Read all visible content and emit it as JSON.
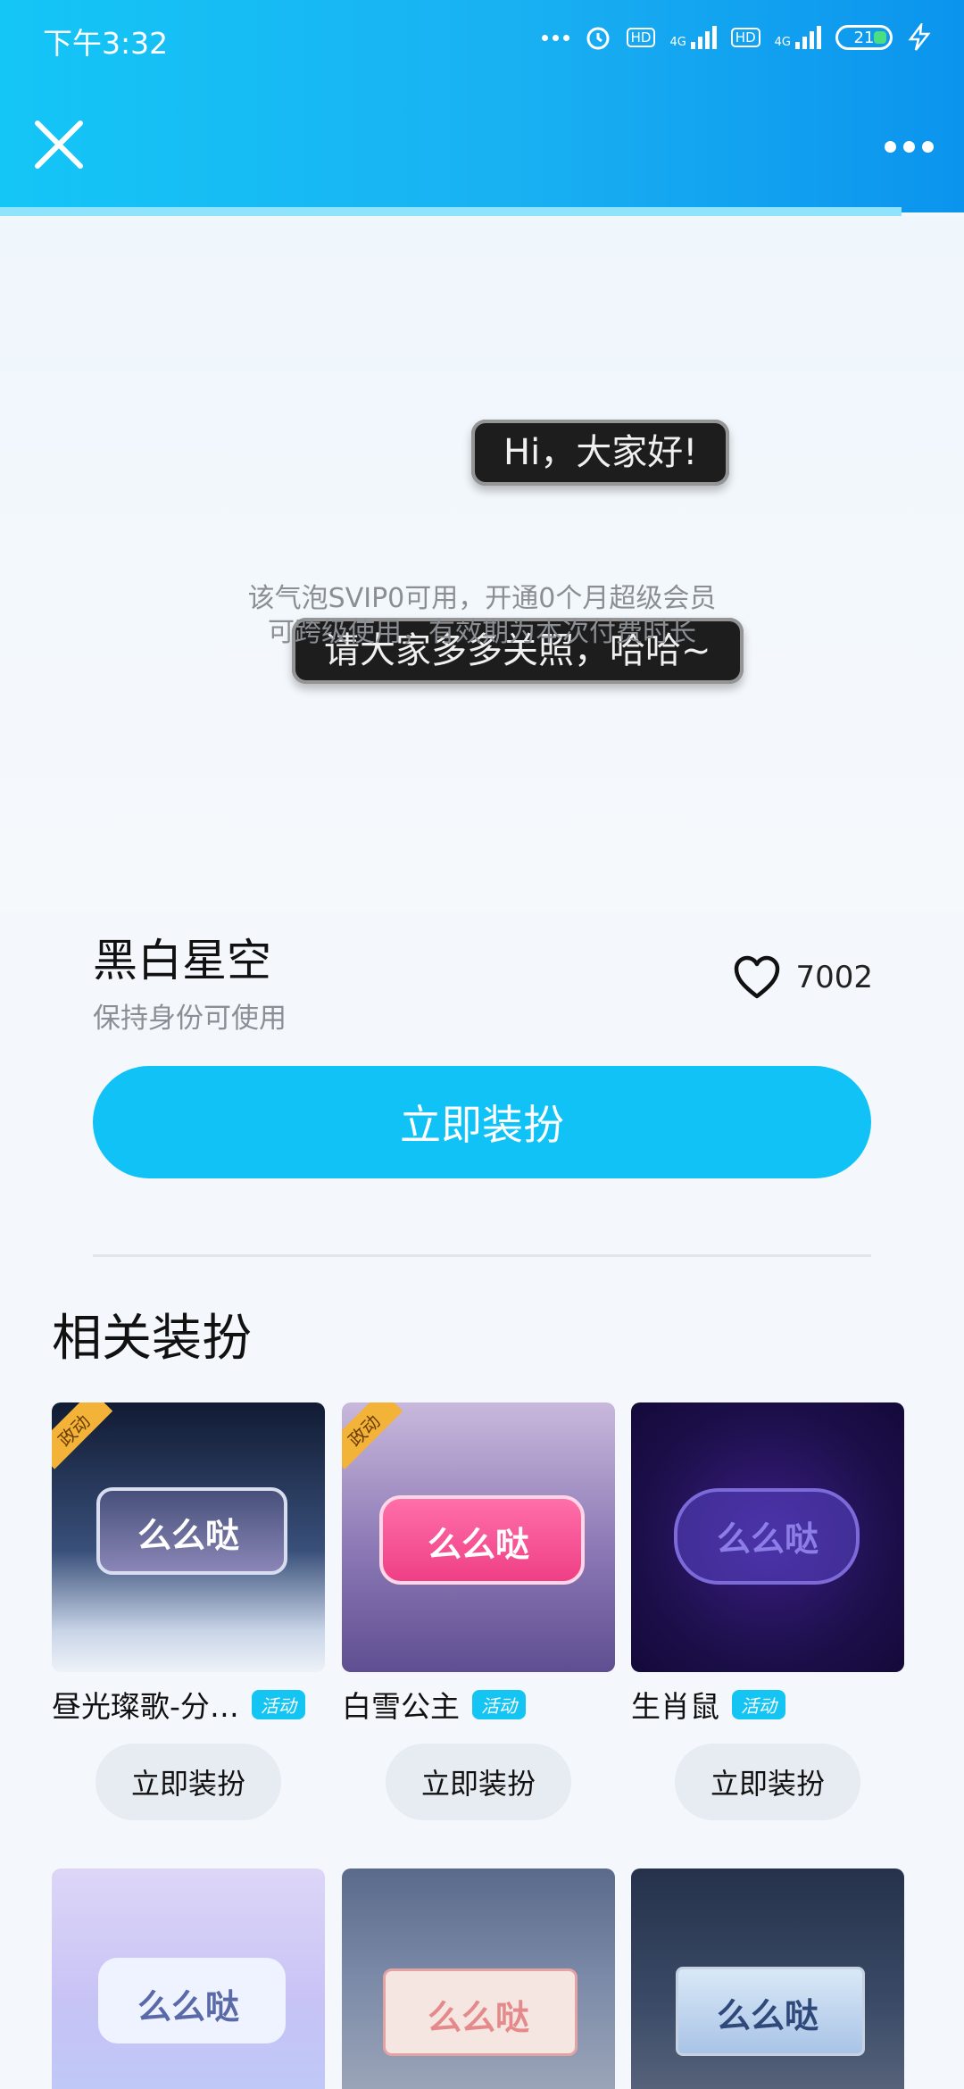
{
  "status_bar": {
    "time": "下午3:32",
    "network1": "4G",
    "network2": "4G",
    "hd1": "HD",
    "hd2": "HD",
    "battery": "21"
  },
  "preview": {
    "bubble1": "Hi，大家好!",
    "bubble2": "请大家多多关照，哈哈~",
    "notice_line1": "该气泡SVIP0可用，开通0个月超级会员",
    "notice_line2": "可跨级使用，有效期为本次付费时长"
  },
  "item": {
    "title": "黑白星空",
    "subtitle": "保持身份可使用",
    "likes": "7002",
    "button": "立即装扮"
  },
  "related": {
    "title": "相关装扮",
    "cards": [
      {
        "name": "昼光璨歌-分…",
        "badge": "活动",
        "corner": "政动",
        "bubble_text": "么么哒",
        "button": "立即装扮"
      },
      {
        "name": "白雪公主",
        "badge": "活动",
        "corner": "政动",
        "bubble_text": "么么哒",
        "button": "立即装扮"
      },
      {
        "name": "生肖鼠",
        "badge": "活动",
        "bubble_text": "么么哒",
        "button": "立即装扮"
      },
      {
        "bubble_text": "么么哒"
      },
      {
        "bubble_text": "么么哒"
      },
      {
        "bubble_text": "么么哒"
      }
    ]
  }
}
